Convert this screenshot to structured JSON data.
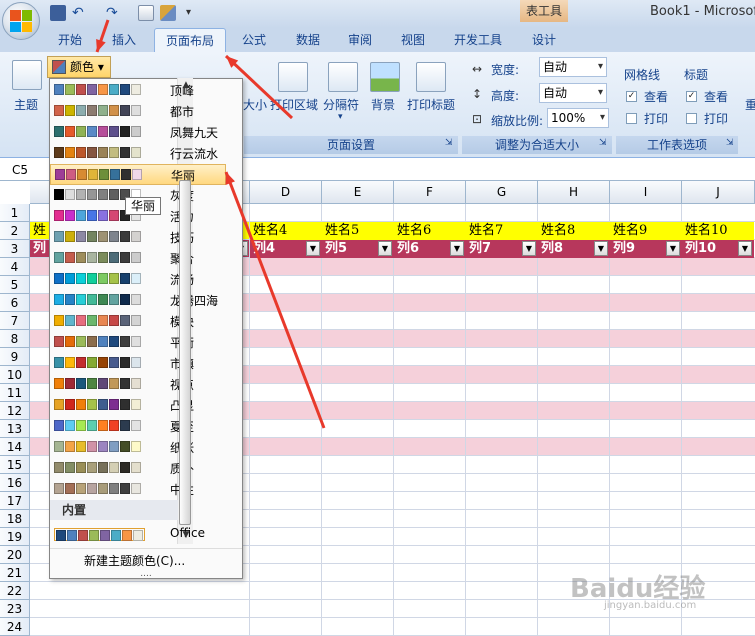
{
  "window": {
    "title": "Book1 - Microsof",
    "context_tab_title": "表工具"
  },
  "tabs": [
    {
      "label": "开始"
    },
    {
      "label": "插入"
    },
    {
      "label": "页面布局"
    },
    {
      "label": "公式"
    },
    {
      "label": "数据"
    },
    {
      "label": "审阅"
    },
    {
      "label": "视图"
    },
    {
      "label": "开发工具"
    },
    {
      "label": "设计"
    }
  ],
  "ribbon": {
    "theme_label": "主题",
    "colors_label": "颜色",
    "margins_hint": "大小",
    "print_area": "打印区域",
    "breaks": "分隔符",
    "background": "背景",
    "print_titles": "打印标题",
    "page_setup_group": "页面设置",
    "width_label": "宽度:",
    "width_value": "自动",
    "height_label": "高度:",
    "height_value": "自动",
    "scale_label": "缩放比例:",
    "scale_value": "100%",
    "fit_group": "调整为合适大小",
    "gridlines_label": "网格线",
    "headings_label": "标题",
    "view_label": "查看",
    "print_label": "打印",
    "sheet_options_group": "工作表选项",
    "arrange_partial": "重"
  },
  "namebox": {
    "value": "C5"
  },
  "columns": [
    "D",
    "E",
    "F",
    "G",
    "H",
    "I",
    "J"
  ],
  "rows": [
    "1",
    "2",
    "3",
    "4",
    "5",
    "6",
    "7",
    "8",
    "9",
    "10",
    "11",
    "12",
    "13",
    "14",
    "15",
    "16",
    "17",
    "18",
    "19",
    "20",
    "21",
    "22",
    "23",
    "24"
  ],
  "sheet": {
    "row2_partial": "姓",
    "row3_partial": "列",
    "names": [
      "姓名4",
      "姓名5",
      "姓名6",
      "姓名7",
      "姓名8",
      "姓名9",
      "姓名10"
    ],
    "headers": [
      "列4",
      "列5",
      "列6",
      "列7",
      "列8",
      "列9",
      "列10"
    ],
    "header_color": "#b7375c",
    "band_color": "#f5d0da",
    "name_row_color": "#ffff00"
  },
  "dropdown": {
    "themes": [
      {
        "label": "顶峰",
        "colors": [
          "#4f81bd",
          "#9bbb59",
          "#c0504d",
          "#8064a2",
          "#f79646",
          "#4bacc6",
          "#1f497d",
          "#eeece1"
        ]
      },
      {
        "label": "都市",
        "colors": [
          "#d16349",
          "#ccb400",
          "#8cadae",
          "#8c7b70",
          "#8fb08c",
          "#d19049",
          "#424456",
          "#dedede"
        ]
      },
      {
        "label": "凤舞九天",
        "colors": [
          "#2c6f6e",
          "#e55a2b",
          "#8fb255",
          "#5a8ac6",
          "#b64e9a",
          "#5d4f8b",
          "#232323",
          "#cccccc"
        ]
      },
      {
        "label": "行云流水",
        "colors": [
          "#5d3a1a",
          "#e48312",
          "#bd582c",
          "#865640",
          "#9b8357",
          "#c2bc80",
          "#333333",
          "#e4e3cc"
        ]
      },
      {
        "label": "华丽",
        "colors": [
          "#9e3d97",
          "#ce5c82",
          "#d78b32",
          "#e0b538",
          "#6e8f3a",
          "#36719b",
          "#303030",
          "#f1d8e8"
        ]
      },
      {
        "label": "灰度",
        "colors": [
          "#000000",
          "#dddddd",
          "#b2b2b2",
          "#969696",
          "#808080",
          "#5f5f5f",
          "#4d4d4d",
          "#ffffff"
        ]
      },
      {
        "label": "活力",
        "colors": [
          "#e32d91",
          "#c830cc",
          "#4ea6dc",
          "#4775e7",
          "#8971e1",
          "#d54773",
          "#262626",
          "#e6e6e6"
        ]
      },
      {
        "label": "技巧",
        "colors": [
          "#6ea0b0",
          "#ccaf0a",
          "#8d89a4",
          "#748560",
          "#9e9273",
          "#7e848d",
          "#3b3b3b",
          "#d4d2d0"
        ]
      },
      {
        "label": "聚合",
        "colors": [
          "#62a39f",
          "#c55d4c",
          "#9e8e5c",
          "#a9b5a0",
          "#7b8c5c",
          "#4d6c78",
          "#3d3d3d",
          "#cccccc"
        ]
      },
      {
        "label": "流畅",
        "colors": [
          "#0f6fc6",
          "#009dd9",
          "#0bd0d9",
          "#10cf9b",
          "#7cca62",
          "#a5c249",
          "#17406d",
          "#dbeff9"
        ]
      },
      {
        "label": "龙腾四海",
        "colors": [
          "#1cade4",
          "#2683c6",
          "#27ced7",
          "#42ba97",
          "#3e8853",
          "#62a39f",
          "#0f2a4c",
          "#dcdcdc"
        ]
      },
      {
        "label": "模块",
        "colors": [
          "#f0ad00",
          "#60b5cc",
          "#e66c7d",
          "#6bb76d",
          "#e88651",
          "#c64847",
          "#5a6378",
          "#d4d4d4"
        ]
      },
      {
        "label": "平衡",
        "colors": [
          "#c0504d",
          "#e46c0a",
          "#9bbb59",
          "#8b6d4c",
          "#4f81bd",
          "#1f497d",
          "#3f3f3f",
          "#dfdfdf"
        ]
      },
      {
        "label": "市镇",
        "colors": [
          "#3891a7",
          "#feb80a",
          "#c32d2e",
          "#84aa33",
          "#964305",
          "#475a8d",
          "#2b2b2b",
          "#dbe5ec"
        ]
      },
      {
        "label": "视点",
        "colors": [
          "#f07f09",
          "#9f2936",
          "#1b587c",
          "#4e8542",
          "#604878",
          "#c19859",
          "#323232",
          "#e5dfd2"
        ]
      },
      {
        "label": "凸显",
        "colors": [
          "#e6a325",
          "#d0261c",
          "#f07f09",
          "#a5c249",
          "#3f5d8f",
          "#7e2e91",
          "#2f2f2f",
          "#f2eed5"
        ]
      },
      {
        "label": "夏至",
        "colors": [
          "#4e67c8",
          "#5eccf3",
          "#a7ea52",
          "#5dceaf",
          "#ff8021",
          "#f14124",
          "#2c3b4f",
          "#e3e3e3"
        ]
      },
      {
        "label": "纸张",
        "colors": [
          "#a5b592",
          "#f3a447",
          "#e7bc29",
          "#d092a7",
          "#9c85c0",
          "#809ec2",
          "#444d26",
          "#fefac9"
        ]
      },
      {
        "label": "质朴",
        "colors": [
          "#928b6b",
          "#838e65",
          "#9a8f58",
          "#a9a07b",
          "#77715a",
          "#d4cfb4",
          "#2d2b25",
          "#e4dfcd"
        ]
      },
      {
        "label": "中性",
        "colors": [
          "#b3a391",
          "#a36f56",
          "#b8a379",
          "#b7a4a0",
          "#a89c7a",
          "#7f7f7f",
          "#3f3f3f",
          "#e8e6df"
        ]
      }
    ],
    "builtin_section": "内置",
    "builtin": {
      "label": "Office",
      "colors": [
        "#1f497d",
        "#4f81bd",
        "#c0504d",
        "#9bbb59",
        "#8064a2",
        "#4bacc6",
        "#f79646",
        "#eeece1"
      ]
    },
    "new_theme_colors": "新建主题颜色(C)...",
    "grip": "....",
    "tooltip": "华丽"
  },
  "watermark": {
    "text": "Baidu经验",
    "url": "jingyan.baidu.com"
  },
  "annotation_color": "#e8392b"
}
